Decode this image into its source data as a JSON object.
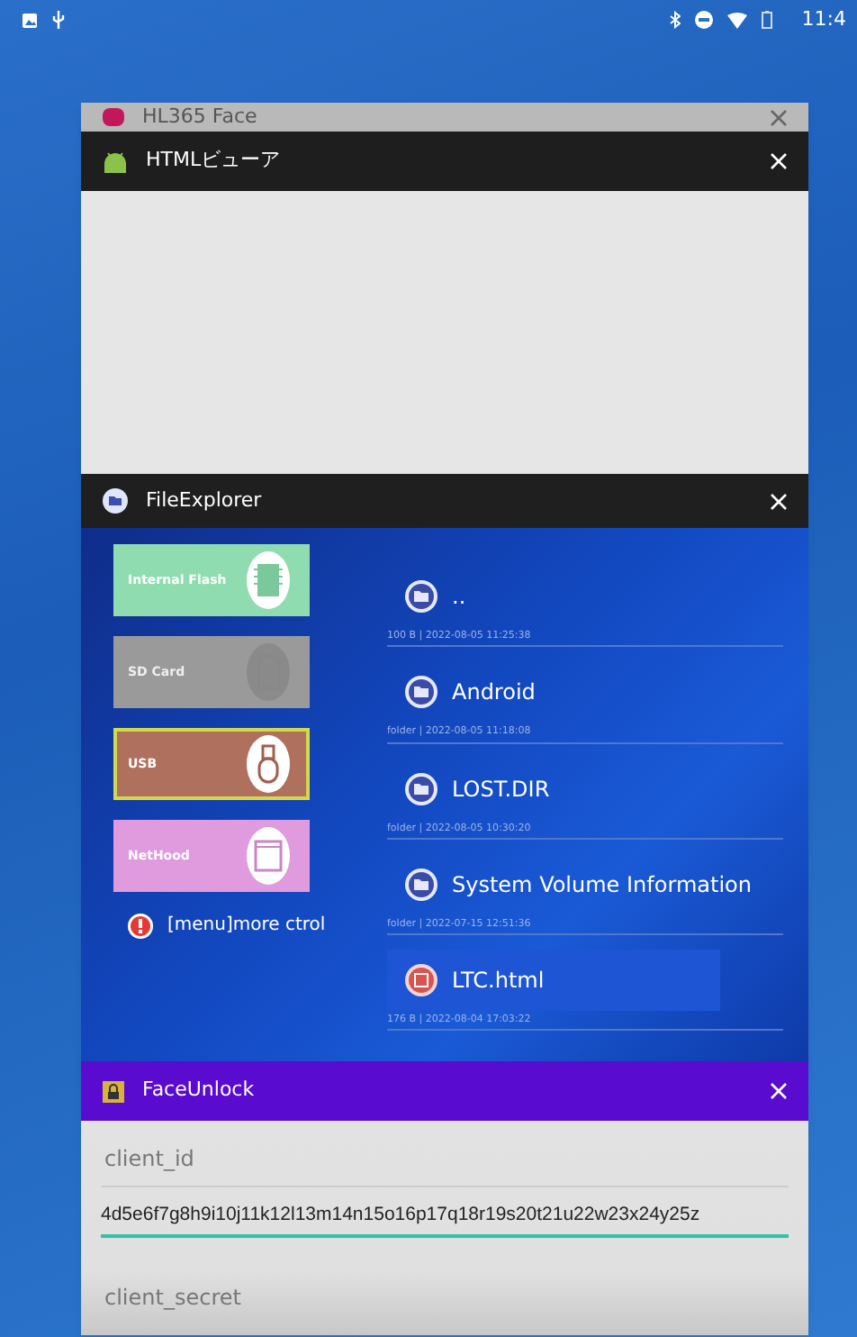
{
  "status_bar": {
    "time": "11:4"
  },
  "cards": [
    {
      "kind": "peek",
      "title": "HL365 Face",
      "color": "#b9b9b9"
    },
    {
      "kind": "blank",
      "title": "HTMLビューア",
      "color": "#1e1e1e"
    },
    {
      "kind": "files",
      "title": "FileExplorer",
      "color": "#1f1f1f",
      "storage": [
        {
          "kind": "chip",
          "label": "Internal Flash",
          "color": "#8fdcb0",
          "selected": false,
          "disabled": false
        },
        {
          "kind": "sdcard",
          "label": "SD Card",
          "color": "#9a9a9a",
          "selected": false,
          "disabled": true
        },
        {
          "kind": "usb",
          "label": "USB",
          "color": "#b0705e",
          "selected": true,
          "disabled": false
        },
        {
          "kind": "window",
          "label": "NetHood",
          "color": "#e09ade",
          "selected": false,
          "disabled": false
        }
      ],
      "hint": "[menu]more ctrol",
      "files": [
        {
          "kind": "folder",
          "name": "..",
          "meta": "100 B | 2022-08-05 11:25:38",
          "selected": false
        },
        {
          "kind": "folder",
          "name": "Android",
          "meta": "folder | 2022-08-05 11:18:08",
          "selected": false
        },
        {
          "kind": "folder",
          "name": "LOST.DIR",
          "meta": "folder | 2022-08-05 10:30:20",
          "selected": false
        },
        {
          "kind": "folder",
          "name": "System Volume Information",
          "meta": "folder | 2022-07-15 12:51:36",
          "selected": false
        },
        {
          "kind": "file",
          "name": "LTC.html",
          "meta": "176 B | 2022-08-04 17:03:22",
          "selected": true
        }
      ]
    },
    {
      "kind": "form",
      "title": "FaceUnlock",
      "color": "#5a0bd0",
      "fields": [
        {
          "label": "client_id",
          "value": "4d5e6f7g8h9i10j11k12l13m14n15o16p17q18r19s20t21u22w23x24y25z",
          "focused": true
        },
        {
          "label": "client_secret"
        }
      ]
    }
  ]
}
